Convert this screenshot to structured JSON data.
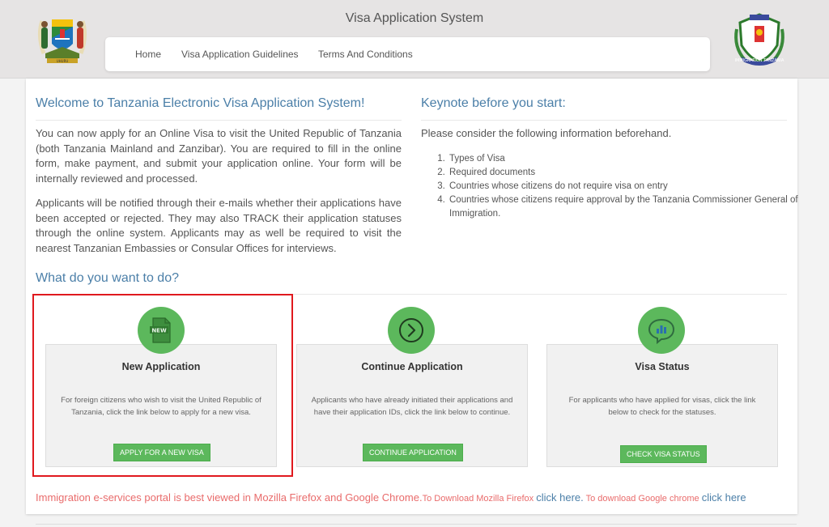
{
  "header": {
    "title": "Visa Application System",
    "nav": [
      "Home",
      "Visa Application Guidelines",
      "Terms And Conditions"
    ],
    "logo_left": "tanzania-coat-of-arms",
    "logo_right": "immigration-tanzania-emblem",
    "logo_right_text": "IMMIGRATION TANZANIA"
  },
  "welcome": {
    "title": "Welcome to Tanzania Electronic Visa Application System!",
    "para1": "You can now apply for an Online Visa to visit the United Republic of Tanzania (both Tanzania Mainland and Zanzibar). You are required to fill in the online form, make payment, and submit your application online. Your form will be internally reviewed and processed.",
    "para2": "Applicants will be notified through their e-mails whether their applications have been accepted or rejected. They may also TRACK their application statuses through the online system. Applicants may as well be required to visit the nearest Tanzanian Embassies or Consular Offices for interviews."
  },
  "keynote": {
    "title": "Keynote before you start:",
    "intro": "Please consider the following information beforehand.",
    "items": [
      "Types of Visa",
      "Required documents",
      "Countries whose citizens do not require visa on entry",
      "Countries whose citizens require approval by the Tanzania Commissioner General of Immigration."
    ]
  },
  "actions": {
    "title": "What do you want to do?",
    "cards": [
      {
        "title": "New Application",
        "desc": "For foreign citizens who wish to visit the United Republic of Tanzania, click the link below to apply for a new visa.",
        "button": "APPLY FOR A NEW VISA",
        "icon": "new-document-icon",
        "icon_text": "NEW"
      },
      {
        "title": "Continue Application",
        "desc": "Applicants who have already initiated their applications and have their application IDs, click the link below to continue.",
        "button": "CONTINUE APPLICATION",
        "icon": "chevron-right-circle-icon"
      },
      {
        "title": "Visa Status",
        "desc": "For applicants who have applied for visas, click the link below to check for the statuses.",
        "button": "CHECK VISA STATUS",
        "icon": "chat-stats-icon"
      }
    ]
  },
  "footer": {
    "main": "Immigration e-services portal is best viewed in Mozilla Firefox and Google Chrome.",
    "firefox_prefix": "To Download Mozilla Firefox ",
    "firefox_link": "click here.",
    "chrome_prefix": " To download Google chrome ",
    "chrome_link": "click here"
  },
  "colors": {
    "accent_blue": "#4b7fa8",
    "button_green": "#5cb85c",
    "footer_red": "#e96b6b",
    "highlight_red": "#e0191e"
  }
}
